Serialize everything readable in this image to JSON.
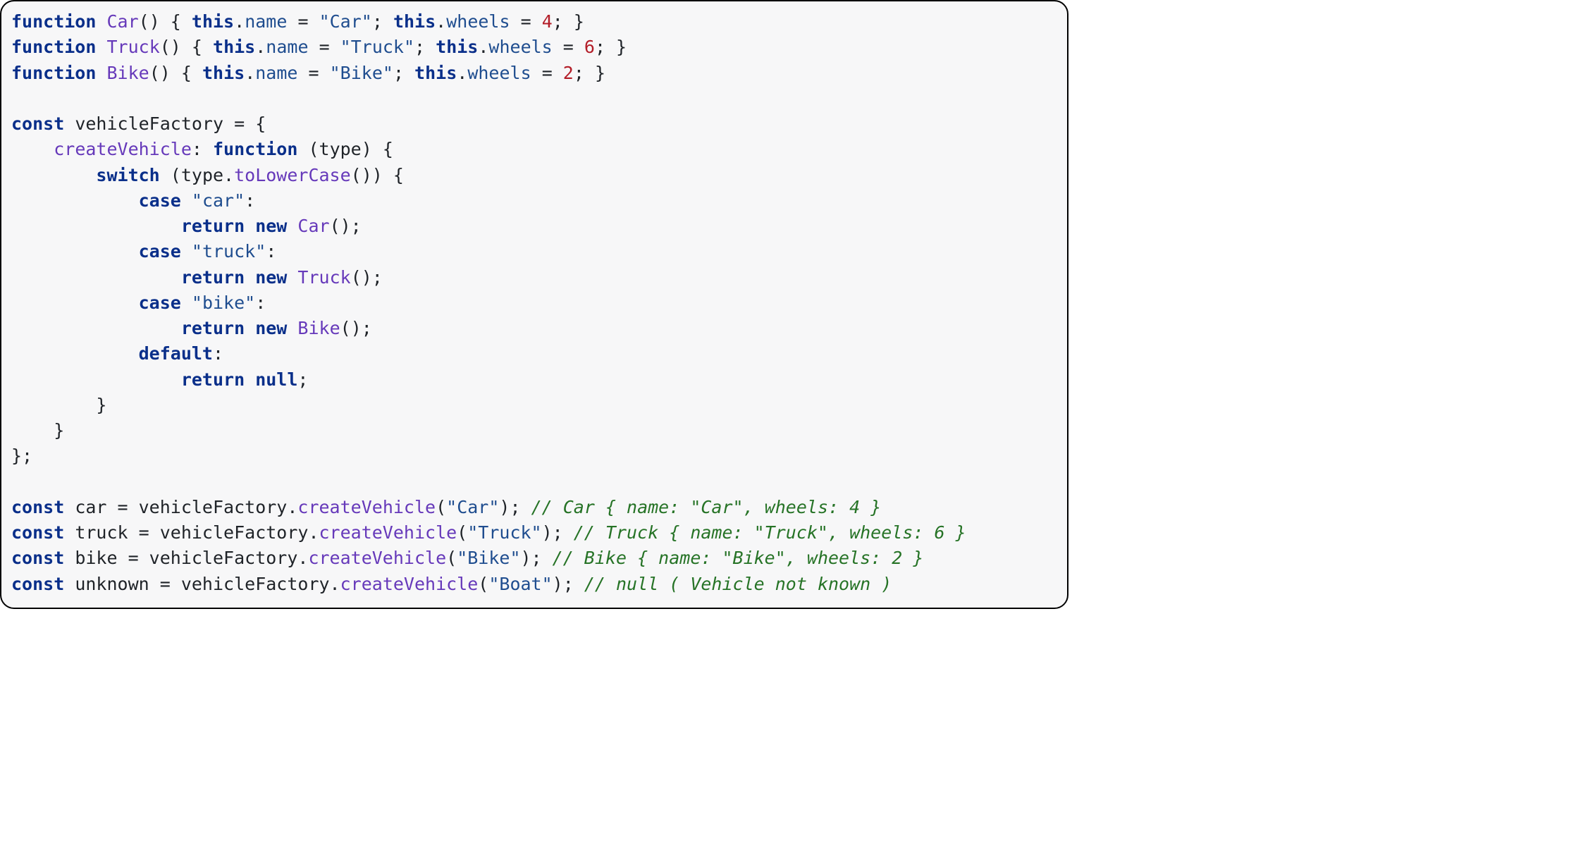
{
  "code": {
    "lines": [
      [
        {
          "cls": "kw",
          "t": "function"
        },
        {
          "t": " "
        },
        {
          "cls": "fn",
          "t": "Car"
        },
        {
          "t": "() { "
        },
        {
          "cls": "kw",
          "t": "this"
        },
        {
          "t": "."
        },
        {
          "cls": "prop",
          "t": "name"
        },
        {
          "t": " = "
        },
        {
          "cls": "str",
          "t": "\"Car\""
        },
        {
          "t": "; "
        },
        {
          "cls": "kw",
          "t": "this"
        },
        {
          "t": "."
        },
        {
          "cls": "prop",
          "t": "wheels"
        },
        {
          "t": " = "
        },
        {
          "cls": "num",
          "t": "4"
        },
        {
          "t": "; }"
        }
      ],
      [
        {
          "cls": "kw",
          "t": "function"
        },
        {
          "t": " "
        },
        {
          "cls": "fn",
          "t": "Truck"
        },
        {
          "t": "() { "
        },
        {
          "cls": "kw",
          "t": "this"
        },
        {
          "t": "."
        },
        {
          "cls": "prop",
          "t": "name"
        },
        {
          "t": " = "
        },
        {
          "cls": "str",
          "t": "\"Truck\""
        },
        {
          "t": "; "
        },
        {
          "cls": "kw",
          "t": "this"
        },
        {
          "t": "."
        },
        {
          "cls": "prop",
          "t": "wheels"
        },
        {
          "t": " = "
        },
        {
          "cls": "num",
          "t": "6"
        },
        {
          "t": "; }"
        }
      ],
      [
        {
          "cls": "kw",
          "t": "function"
        },
        {
          "t": " "
        },
        {
          "cls": "fn",
          "t": "Bike"
        },
        {
          "t": "() { "
        },
        {
          "cls": "kw",
          "t": "this"
        },
        {
          "t": "."
        },
        {
          "cls": "prop",
          "t": "name"
        },
        {
          "t": " = "
        },
        {
          "cls": "str",
          "t": "\"Bike\""
        },
        {
          "t": "; "
        },
        {
          "cls": "kw",
          "t": "this"
        },
        {
          "t": "."
        },
        {
          "cls": "prop",
          "t": "wheels"
        },
        {
          "t": " = "
        },
        {
          "cls": "num",
          "t": "2"
        },
        {
          "t": "; }"
        }
      ],
      [],
      [
        {
          "cls": "kw",
          "t": "const"
        },
        {
          "t": " vehicleFactory = {"
        }
      ],
      [
        {
          "t": "    "
        },
        {
          "cls": "fn",
          "t": "createVehicle"
        },
        {
          "t": ": "
        },
        {
          "cls": "kw",
          "t": "function"
        },
        {
          "t": " (type) {"
        }
      ],
      [
        {
          "t": "        "
        },
        {
          "cls": "kw",
          "t": "switch"
        },
        {
          "t": " (type."
        },
        {
          "cls": "fn",
          "t": "toLowerCase"
        },
        {
          "t": "()) {"
        }
      ],
      [
        {
          "t": "            "
        },
        {
          "cls": "kw",
          "t": "case"
        },
        {
          "t": " "
        },
        {
          "cls": "str",
          "t": "\"car\""
        },
        {
          "t": ":"
        }
      ],
      [
        {
          "t": "                "
        },
        {
          "cls": "kw",
          "t": "return"
        },
        {
          "t": " "
        },
        {
          "cls": "kw",
          "t": "new"
        },
        {
          "t": " "
        },
        {
          "cls": "fn",
          "t": "Car"
        },
        {
          "t": "();"
        }
      ],
      [
        {
          "t": "            "
        },
        {
          "cls": "kw",
          "t": "case"
        },
        {
          "t": " "
        },
        {
          "cls": "str",
          "t": "\"truck\""
        },
        {
          "t": ":"
        }
      ],
      [
        {
          "t": "                "
        },
        {
          "cls": "kw",
          "t": "return"
        },
        {
          "t": " "
        },
        {
          "cls": "kw",
          "t": "new"
        },
        {
          "t": " "
        },
        {
          "cls": "fn",
          "t": "Truck"
        },
        {
          "t": "();"
        }
      ],
      [
        {
          "t": "            "
        },
        {
          "cls": "kw",
          "t": "case"
        },
        {
          "t": " "
        },
        {
          "cls": "str",
          "t": "\"bike\""
        },
        {
          "t": ":"
        }
      ],
      [
        {
          "t": "                "
        },
        {
          "cls": "kw",
          "t": "return"
        },
        {
          "t": " "
        },
        {
          "cls": "kw",
          "t": "new"
        },
        {
          "t": " "
        },
        {
          "cls": "fn",
          "t": "Bike"
        },
        {
          "t": "();"
        }
      ],
      [
        {
          "t": "            "
        },
        {
          "cls": "kw",
          "t": "default"
        },
        {
          "t": ":"
        }
      ],
      [
        {
          "t": "                "
        },
        {
          "cls": "kw",
          "t": "return"
        },
        {
          "t": " "
        },
        {
          "cls": "kw",
          "t": "null"
        },
        {
          "t": ";"
        }
      ],
      [
        {
          "t": "        }"
        }
      ],
      [
        {
          "t": "    }"
        }
      ],
      [
        {
          "t": "};"
        }
      ],
      [],
      [
        {
          "cls": "kw",
          "t": "const"
        },
        {
          "t": " car = vehicleFactory."
        },
        {
          "cls": "fn",
          "t": "createVehicle"
        },
        {
          "t": "("
        },
        {
          "cls": "str",
          "t": "\"Car\""
        },
        {
          "t": "); "
        },
        {
          "cls": "com",
          "t": "// Car { name: \"Car\", wheels: 4 }"
        }
      ],
      [
        {
          "cls": "kw",
          "t": "const"
        },
        {
          "t": " truck = vehicleFactory."
        },
        {
          "cls": "fn",
          "t": "createVehicle"
        },
        {
          "t": "("
        },
        {
          "cls": "str",
          "t": "\"Truck\""
        },
        {
          "t": "); "
        },
        {
          "cls": "com",
          "t": "// Truck { name: \"Truck\", wheels: 6 }"
        }
      ],
      [
        {
          "cls": "kw",
          "t": "const"
        },
        {
          "t": " bike = vehicleFactory."
        },
        {
          "cls": "fn",
          "t": "createVehicle"
        },
        {
          "t": "("
        },
        {
          "cls": "str",
          "t": "\"Bike\""
        },
        {
          "t": "); "
        },
        {
          "cls": "com",
          "t": "// Bike { name: \"Bike\", wheels: 2 }"
        }
      ],
      [
        {
          "cls": "kw",
          "t": "const"
        },
        {
          "t": " unknown = vehicleFactory."
        },
        {
          "cls": "fn",
          "t": "createVehicle"
        },
        {
          "t": "("
        },
        {
          "cls": "str",
          "t": "\"Boat\""
        },
        {
          "t": "); "
        },
        {
          "cls": "com",
          "t": "// null ( Vehicle not known )"
        }
      ]
    ]
  }
}
